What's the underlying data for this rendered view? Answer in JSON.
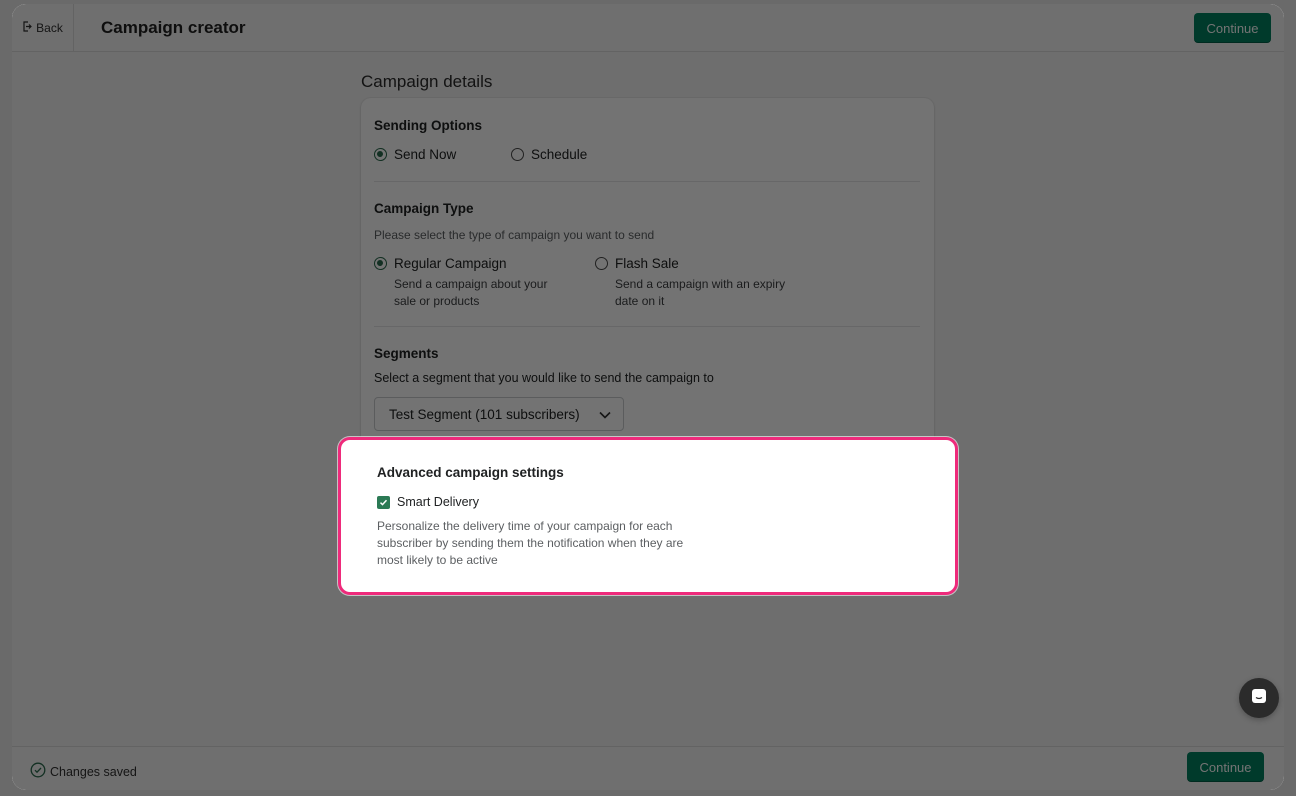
{
  "header": {
    "back_label": "Back",
    "title": "Campaign creator",
    "continue_label": "Continue"
  },
  "main": {
    "section_title": "Campaign details",
    "sending_options": {
      "heading": "Sending Options",
      "options": [
        {
          "label": "Send Now",
          "selected": true
        },
        {
          "label": "Schedule",
          "selected": false
        }
      ]
    },
    "campaign_type": {
      "heading": "Campaign Type",
      "help": "Please select the type of campaign you want to send",
      "options": [
        {
          "label": "Regular Campaign",
          "selected": true,
          "description_line1": "Send a campaign about your",
          "description_line2": "sale or products"
        },
        {
          "label": "Flash Sale",
          "selected": false,
          "description_line1": "Send a campaign with an expiry",
          "description_line2": "date on it"
        }
      ]
    },
    "segments": {
      "heading": "Segments",
      "help": "Select a segment that you would like to send the campaign to",
      "selected_value": "Test Segment (101 subscribers)"
    },
    "advanced": {
      "heading": "Advanced campaign settings",
      "checkbox_label": "Smart Delivery",
      "checked": true,
      "description_line1": "Personalize the delivery time of your campaign for each",
      "description_line2": "subscriber by sending them the notification when they are",
      "description_line3": "most likely to be active"
    }
  },
  "footer": {
    "status": "Changes saved",
    "continue_label": "Continue"
  },
  "colors": {
    "primary": "#008060",
    "highlight": "#ee2a7b"
  },
  "icons": {
    "back": "exit-icon",
    "status": "check-circle-icon",
    "chat": "chat-icon",
    "select": "chevron-down-icon"
  }
}
